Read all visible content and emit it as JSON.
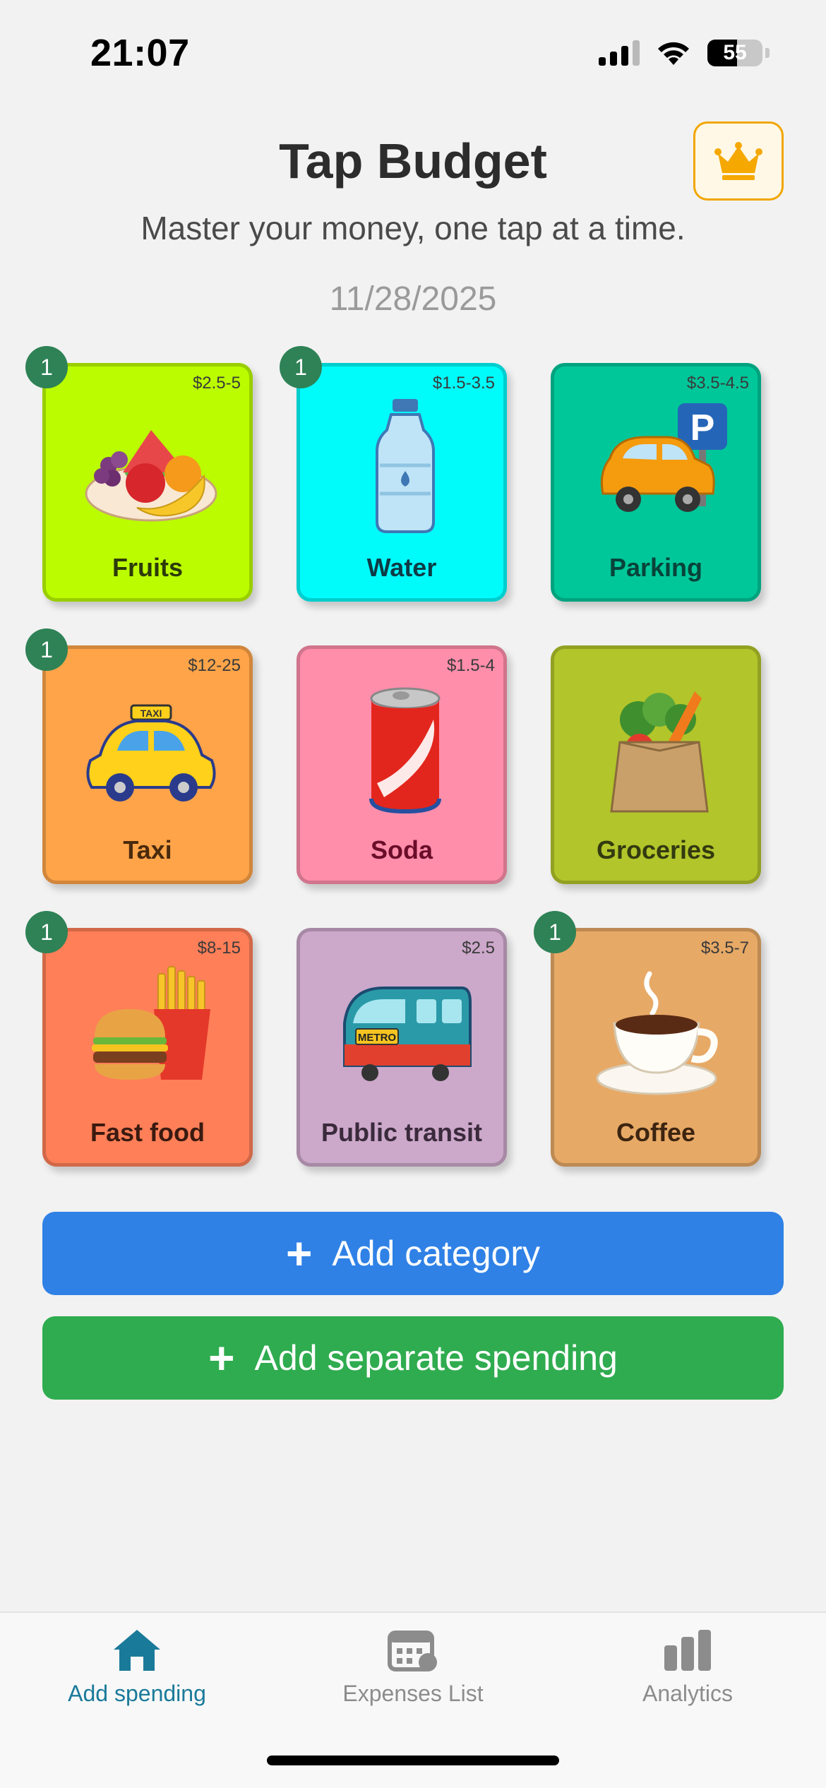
{
  "status": {
    "time": "21:07",
    "battery": "55"
  },
  "header": {
    "title": "Tap Budget",
    "subtitle": "Master your money, one tap at a time.",
    "date": "11/28/2025",
    "premium_icon": "crown-icon"
  },
  "categories": [
    {
      "name": "Fruits",
      "price": "$2.5-5",
      "count": "1",
      "bg": "#bbfc00",
      "text": "#2c3a0a"
    },
    {
      "name": "Water",
      "price": "$1.5-3.5",
      "count": "1",
      "bg": "#00fbfb",
      "text": "#0e3b46"
    },
    {
      "name": "Parking",
      "price": "$3.5-4.5",
      "count": "",
      "bg": "#00c79a",
      "text": "#08433a"
    },
    {
      "name": "Taxi",
      "price": "$12-25",
      "count": "1",
      "bg": "#ffa449",
      "text": "#4a2a0c"
    },
    {
      "name": "Soda",
      "price": "$1.5-4",
      "count": "",
      "bg": "#ff8eab",
      "text": "#6a0d2a"
    },
    {
      "name": "Groceries",
      "price": "",
      "count": "",
      "bg": "#b2c52a",
      "text": "#333a10"
    },
    {
      "name": "Fast food",
      "price": "$8-15",
      "count": "1",
      "bg": "#ff7f58",
      "text": "#3a1a10"
    },
    {
      "name": "Public transit",
      "price": "$2.5",
      "count": "",
      "bg": "#cca8ca",
      "text": "#3a2a3c"
    },
    {
      "name": "Coffee",
      "price": "$3.5-7",
      "count": "1",
      "bg": "#e7a966",
      "text": "#3c2410"
    }
  ],
  "actions": {
    "add_category": "Add category",
    "add_category_color": "#2f81e6",
    "add_spending": "Add separate spending",
    "add_spending_color": "#2fac4f"
  },
  "tabs": [
    {
      "label": "Add spending",
      "icon": "home-icon",
      "active": true
    },
    {
      "label": "Expenses List",
      "icon": "calendar-icon",
      "active": false
    },
    {
      "label": "Analytics",
      "icon": "bar-chart-icon",
      "active": false
    }
  ]
}
